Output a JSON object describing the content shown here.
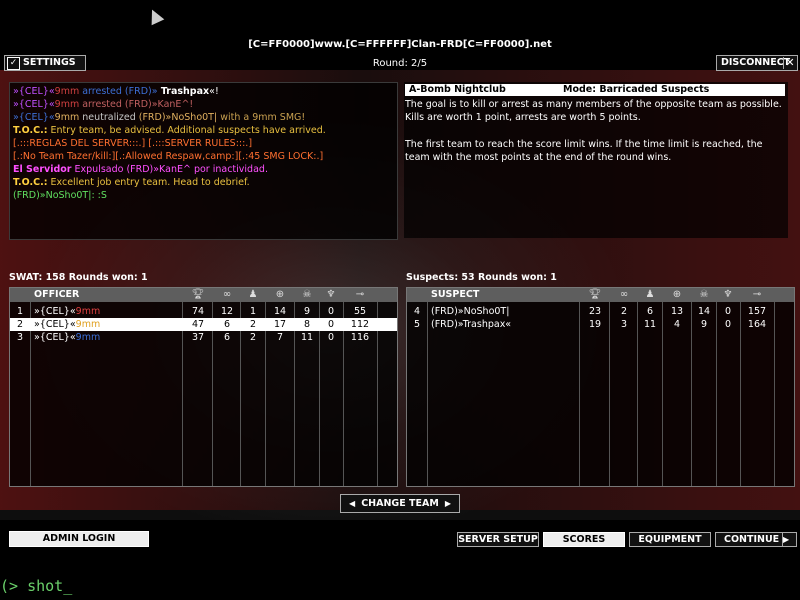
{
  "header": {
    "server_name": "[C=FF0000]www.[C=FFFFFF]Clan-FRD[C=FF0000].net",
    "round": "Round: 2/5",
    "settings_label": "SETTINGS",
    "settings_check": "✓",
    "disconnect_label": "DISCONNECT",
    "disconnect_x": "✕"
  },
  "chat": [
    {
      "parts": [
        {
          "t": "»{CEL}«",
          "c": "#c050ff"
        },
        {
          "t": "9mm",
          "c": "#d04040"
        },
        {
          "t": " arrested ",
          "c": "#3d6fd6"
        },
        {
          "t": "(FRD)»",
          "c": "#3d6fd6"
        },
        {
          "t": " Trashpax",
          "c": "#ffffff"
        },
        {
          "t": "«!",
          "c": "#ffffff"
        }
      ]
    },
    {
      "parts": [
        {
          "t": "»{CEL}«",
          "c": "#c050ff"
        },
        {
          "t": "9mm",
          "c": "#d04040"
        },
        {
          "t": " arrested ",
          "c": "#c06060"
        },
        {
          "t": "(FRD)»",
          "c": "#c06060"
        },
        {
          "t": "KanE^!",
          "c": "#c06060"
        }
      ]
    },
    {
      "parts": [
        {
          "t": "»{CEL}«",
          "c": "#3d6fd6"
        },
        {
          "t": "9mm",
          "c": "#e0b060"
        },
        {
          "t": " neutralized ",
          "c": "#c8c8c8"
        },
        {
          "t": "(FRD)»NoSho0T|",
          "c": "#e0b060"
        },
        {
          "t": " with a 9mm SMG!",
          "c": "#c8a050"
        }
      ]
    },
    {
      "parts": [
        {
          "t": "T.O.C.:",
          "c": "#ffd040"
        },
        {
          "t": " Entry team, be advised.  Additional suspects have arrived.",
          "c": "#e8c040"
        }
      ]
    },
    {
      "parts": [
        {
          "t": "[.:::REGLAS DEL SERVER:::.] [.:::SERVER RULES:::.]",
          "c": "#ff7030"
        }
      ]
    },
    {
      "parts": [
        {
          "t": "[.:No Team Tazer/kill:][.:Allowed Respaw,camp:][.:45 SMG LOCK:.]",
          "c": "#ff7030"
        }
      ]
    },
    {
      "parts": [
        {
          "t": "El Servidor",
          "c": "#ff50ff"
        },
        {
          "t": " Expulsado ",
          "c": "#ff50ff"
        },
        {
          "t": "(FRD)»KanE^",
          "c": "#ff50ff"
        },
        {
          "t": " por inactividad.",
          "c": "#ff50ff"
        }
      ]
    },
    {
      "parts": [
        {
          "t": "T.O.C.:",
          "c": "#ffd040"
        },
        {
          "t": " Excellent job entry team.  Head to debrief.",
          "c": "#e8c040"
        }
      ]
    },
    {
      "parts": [
        {
          "t": "(FRD)»NoSho0T|",
          "c": "#60e060"
        },
        {
          "t": ": :S",
          "c": "#60e060"
        }
      ]
    }
  ],
  "info": {
    "map": "A-Bomb Nightclub",
    "mode": "Mode: Barricaded Suspects",
    "para1": "The goal is to kill or arrest as many members of the opposite team as possible.  Kills are worth 1 point, arrests are worth 5 points.",
    "para2": "The first team to reach the score limit wins.  If the time limit is reached, the team with the most points at the end of the round wins."
  },
  "swat": {
    "summary": "SWAT: 158    Rounds won: 1",
    "header": "OFFICER",
    "rows": [
      {
        "num": "1",
        "name_parts": [
          {
            "t": "»{CEL}«",
            "c": "#ffffff"
          },
          {
            "t": "9mm",
            "c": "#e04040"
          }
        ],
        "score": "74",
        "kills": "12",
        "arrests": "1",
        "deaths": "14",
        "tkills": "9",
        "tarrests": "0",
        "ping": "55",
        "selected": false
      },
      {
        "num": "2",
        "name_parts": [
          {
            "t": "»{CEL}«",
            "c": "#000000"
          },
          {
            "t": "9mm",
            "c": "#e0a020"
          }
        ],
        "score": "47",
        "kills": "6",
        "arrests": "2",
        "deaths": "17",
        "tkills": "8",
        "tarrests": "0",
        "ping": "112",
        "selected": true
      },
      {
        "num": "3",
        "name_parts": [
          {
            "t": "»{CEL}«",
            "c": "#ffffff"
          },
          {
            "t": "9mm",
            "c": "#3d6fd6"
          }
        ],
        "score": "37",
        "kills": "6",
        "arrests": "2",
        "deaths": "7",
        "tkills": "11",
        "tarrests": "0",
        "ping": "116",
        "selected": false
      }
    ]
  },
  "suspects": {
    "summary": "Suspects: 53    Rounds won: 1",
    "header": "SUSPECT",
    "rows": [
      {
        "num": "4",
        "name_parts": [
          {
            "t": "(FRD)»NoSho0T|",
            "c": "#ffffff"
          }
        ],
        "score": "23",
        "kills": "2",
        "arrests": "6",
        "deaths": "13",
        "tkills": "14",
        "tarrests": "0",
        "ping": "157",
        "selected": false
      },
      {
        "num": "5",
        "name_parts": [
          {
            "t": "(FRD)»Trashpax«",
            "c": "#ffffff"
          }
        ],
        "score": "19",
        "kills": "3",
        "arrests": "11",
        "deaths": "4",
        "tkills": "9",
        "tarrests": "0",
        "ping": "164",
        "selected": false
      }
    ]
  },
  "column_icons": [
    "trophy-icon",
    "handcuffs-icon",
    "arrest-icon",
    "crosshair-icon",
    "skull-icon",
    "tarrest-icon",
    "ping-icon"
  ],
  "buttons": {
    "change_team": "CHANGE TEAM",
    "admin_login": "ADMIN LOGIN",
    "server_setup": "SERVER SETUP",
    "scores": "SCORES",
    "equipment": "EQUIPMENT",
    "continue": "CONTINUE",
    "left_arrow": "◀",
    "right_arrow": "▶"
  },
  "console": "(> shot_"
}
